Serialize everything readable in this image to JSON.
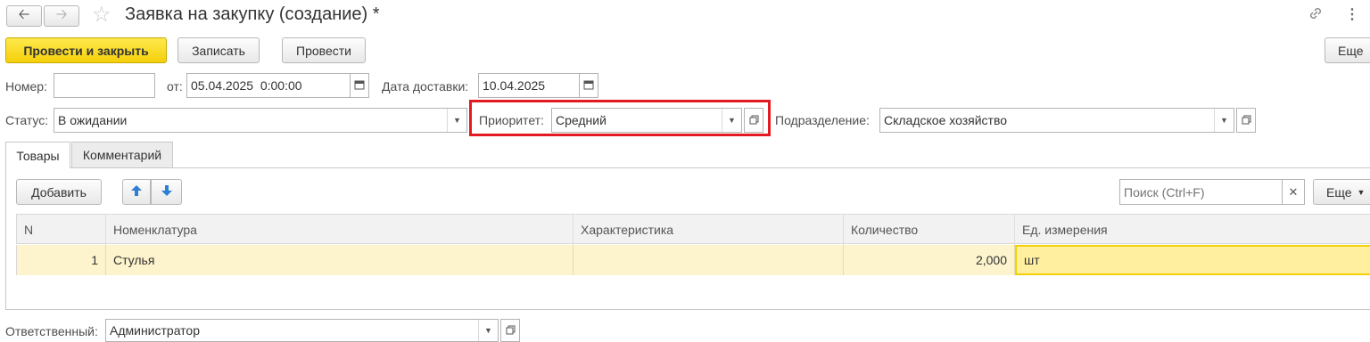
{
  "window": {
    "title": "Заявка на закупку (создание) *"
  },
  "toolbar": {
    "post_and_close": "Провести и закрыть",
    "save": "Записать",
    "post": "Провести",
    "more": "Еще"
  },
  "header": {
    "number_label": "Номер:",
    "number_value": "",
    "from_label": "от:",
    "from_value": "05.04.2025  0:00:00",
    "delivery_label": "Дата доставки:",
    "delivery_value": "10.04.2025",
    "status_label": "Статус:",
    "status_value": "В ожидании",
    "priority_label": "Приоритет:",
    "priority_value": "Средний",
    "division_label": "Подразделение:",
    "division_value": "Складское хозяйство"
  },
  "tabs": [
    {
      "label": "Товары",
      "active": true
    },
    {
      "label": "Комментарий",
      "active": false
    }
  ],
  "goods": {
    "add_label": "Добавить",
    "search_placeholder": "Поиск (Ctrl+F)",
    "more_label": "Еще",
    "columns": [
      "N",
      "Номенклатура",
      "Характеристика",
      "Количество",
      "Ед. измерения"
    ],
    "rows": [
      {
        "n": "1",
        "item": "Стулья",
        "characteristic": "",
        "quantity": "2,000",
        "unit": "шт"
      }
    ]
  },
  "footer": {
    "responsible_label": "Ответственный:",
    "responsible_value": "Администратор"
  },
  "colors": {
    "accent_yellow": "#f4cf0a",
    "highlight_box": "#e21b23",
    "selected_row": "#fdf3cc"
  },
  "icons": [
    "back-arrow-icon",
    "forward-arrow-icon",
    "star-icon",
    "link-icon",
    "kebab-menu-icon",
    "calendar-icon",
    "open-icon",
    "arrow-up-icon",
    "arrow-down-icon",
    "clear-icon",
    "chevron-down-icon"
  ]
}
